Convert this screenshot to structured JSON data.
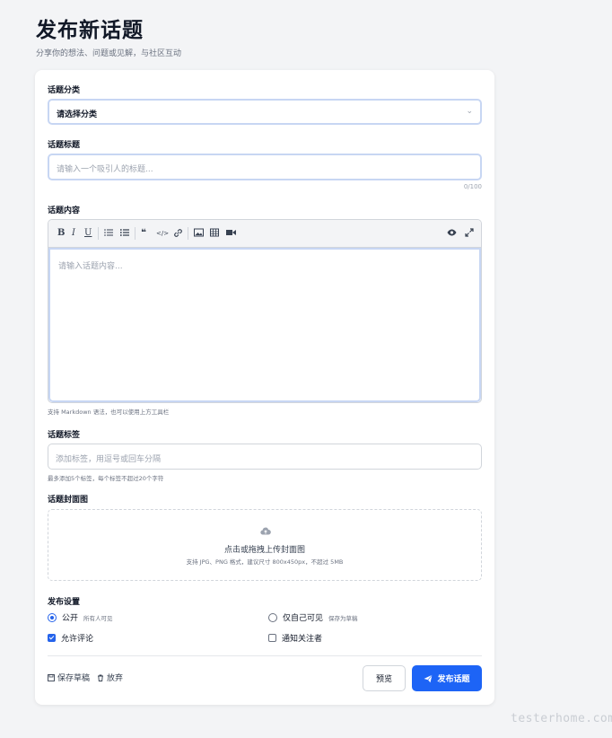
{
  "page": {
    "title": "发布新话题",
    "subtitle": "分享你的想法、问题或见解，与社区互动"
  },
  "category": {
    "label": "话题分类",
    "value": "请选择分类"
  },
  "topic_title": {
    "label": "话题标题",
    "placeholder": "请输入一个吸引人的标题...",
    "counter": "0/100"
  },
  "content": {
    "label": "话题内容",
    "placeholder": "请输入话题内容...",
    "hint": "支持 Markdown 语法，也可以使用上方工具栏",
    "toolbar": {
      "bold": "B",
      "italic": "I",
      "underline": "U",
      "ordered_list": "≔",
      "bullet_list": "☰",
      "quote": "❝",
      "code": "</>",
      "link": "🔗"
    }
  },
  "tags": {
    "label": "话题标签",
    "placeholder": "添加标签，用逗号或回车分隔",
    "hint": "最多添加5个标签，每个标签不超过20个字符"
  },
  "cover": {
    "label": "话题封面图",
    "main_text": "点击或拖拽上传封面图",
    "sub_text": "支持 JPG、PNG 格式，建议尺寸 800x450px，不超过 5MB"
  },
  "settings": {
    "label": "发布设置",
    "public_label": "公开",
    "public_desc": "所有人可见",
    "private_label": "仅自己可见",
    "private_desc": "保存为草稿",
    "comments_label": "允许评论",
    "notify_label": "通知关注者",
    "public_selected": true,
    "comments_checked": true,
    "notify_checked": false
  },
  "actions": {
    "save_draft": "保存草稿",
    "discard": "放弃",
    "preview": "预览",
    "publish": "发布话题"
  },
  "watermark": "testerhome.com",
  "colors": {
    "primary": "#1d64f6",
    "focus_border": "#c7d6f3",
    "background": "#f3f4f6"
  }
}
